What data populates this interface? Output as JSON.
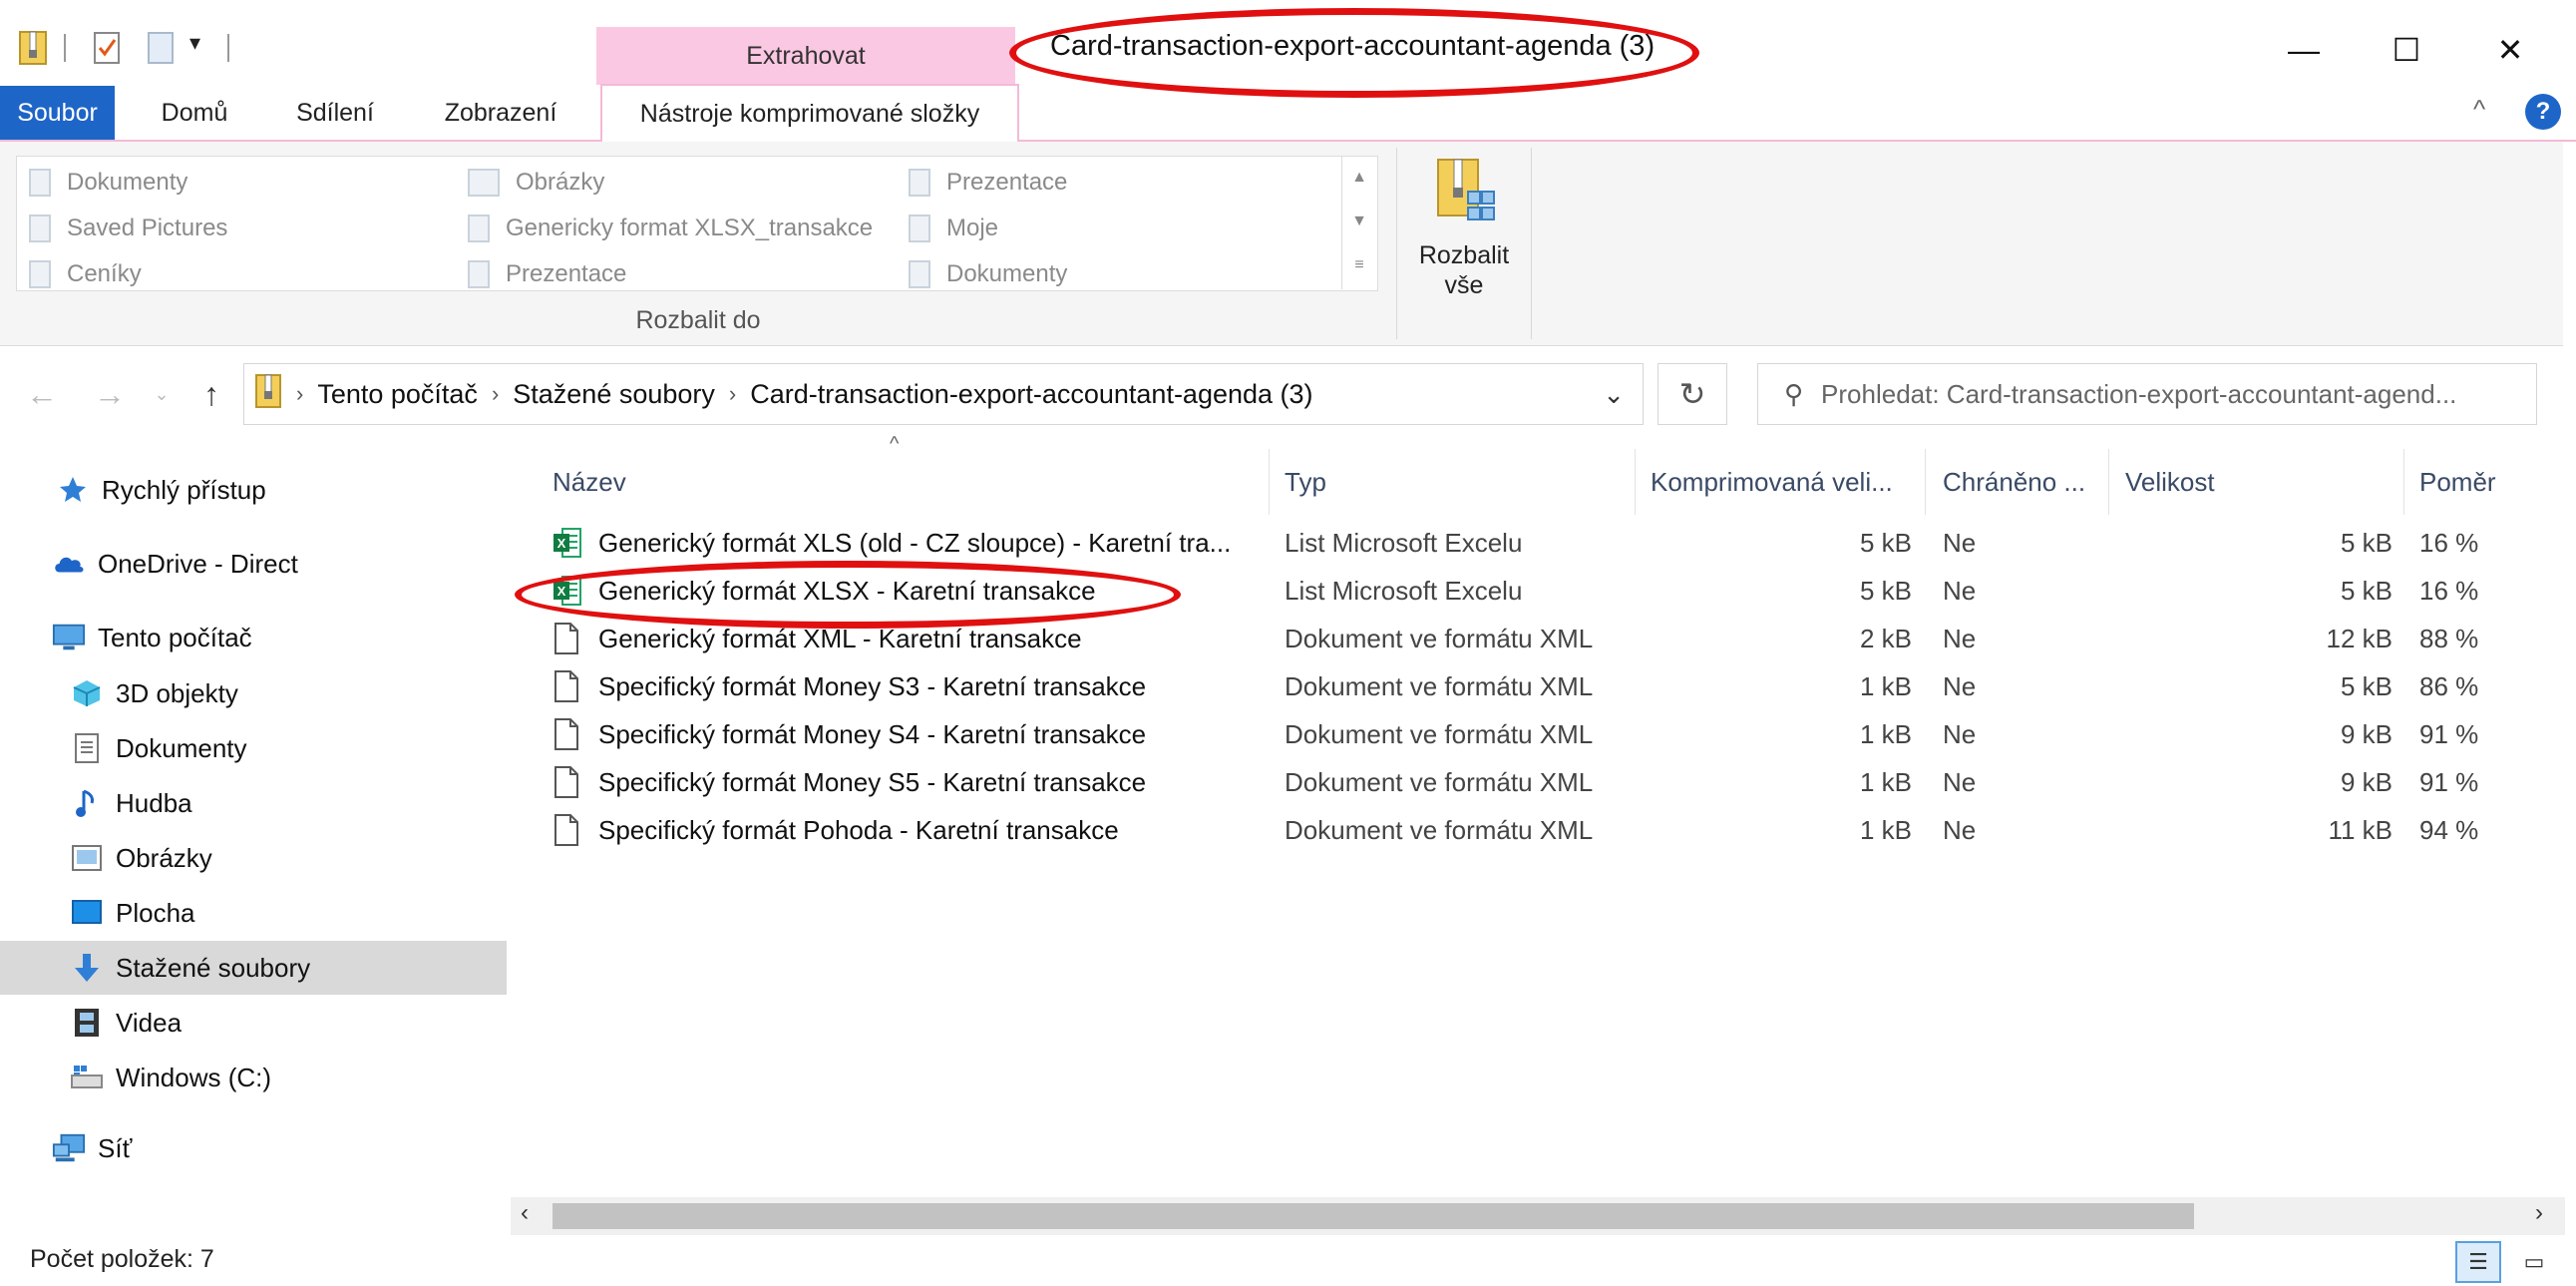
{
  "window": {
    "title": "Card-transaction-export-accountant-agenda (3)",
    "controls": [
      "—",
      "☐",
      "✕"
    ]
  },
  "ribbon": {
    "context_tab_group": "Extrahovat",
    "tabs": [
      "Soubor",
      "Domů",
      "Sdílení",
      "Zobrazení",
      "Nástroje komprimované složky"
    ],
    "gallery": [
      [
        "Dokumenty",
        "Obrázky",
        "Prezentace"
      ],
      [
        "Saved Pictures",
        "Genericky format XLSX_transakce",
        "Moje"
      ],
      [
        "Ceníky",
        "Prezentace",
        "Dokumenty"
      ]
    ],
    "group_label": "Rozbalit do",
    "extract_all_line1": "Rozbalit",
    "extract_all_line2": "vše",
    "help": "?",
    "collapse": "^"
  },
  "address": {
    "crumbs": [
      "Tento počítač",
      "Stažené soubory",
      "Card-transaction-export-accountant-agenda (3)"
    ],
    "search_placeholder": "Prohledat: Card-transaction-export-accountant-agend..."
  },
  "nav_pane": {
    "quick_access": "Rychlý přístup",
    "onedrive": "OneDrive - Direct",
    "this_pc": "Tento počítač",
    "children": [
      "3D objekty",
      "Dokumenty",
      "Hudba",
      "Obrázky",
      "Plocha",
      "Stažené soubory",
      "Videa",
      "Windows (C:)"
    ],
    "network": "Síť"
  },
  "columns": {
    "name": "Název",
    "type": "Typ",
    "compressed": "Komprimovaná veli...",
    "protected": "Chráněno ...",
    "size": "Velikost",
    "ratio": "Poměr"
  },
  "files": [
    {
      "name": "Generický formát XLS (old - CZ sloupce) - Karetní tra...",
      "type": "List Microsoft Excelu",
      "compressed": "5 kB",
      "protected": "Ne",
      "size": "5 kB",
      "ratio": "16 %",
      "icon": "excel-file-icon"
    },
    {
      "name": "Generický formát XLSX - Karetní transakce",
      "type": "List Microsoft Excelu",
      "compressed": "5 kB",
      "protected": "Ne",
      "size": "5 kB",
      "ratio": "16 %",
      "icon": "excel-file-icon"
    },
    {
      "name": "Generický formát XML - Karetní transakce",
      "type": "Dokument ve formátu XML",
      "compressed": "2 kB",
      "protected": "Ne",
      "size": "12 kB",
      "ratio": "88 %",
      "icon": "xml-file-icon"
    },
    {
      "name": "Specifický formát Money S3 - Karetní transakce",
      "type": "Dokument ve formátu XML",
      "compressed": "1 kB",
      "protected": "Ne",
      "size": "5 kB",
      "ratio": "86 %",
      "icon": "xml-file-icon"
    },
    {
      "name": "Specifický formát Money S4 - Karetní transakce",
      "type": "Dokument ve formátu XML",
      "compressed": "1 kB",
      "protected": "Ne",
      "size": "9 kB",
      "ratio": "91 %",
      "icon": "xml-file-icon"
    },
    {
      "name": "Specifický formát Money S5 - Karetní transakce",
      "type": "Dokument ve formátu XML",
      "compressed": "1 kB",
      "protected": "Ne",
      "size": "9 kB",
      "ratio": "91 %",
      "icon": "xml-file-icon"
    },
    {
      "name": "Specifický formát Pohoda - Karetní transakce",
      "type": "Dokument ve formátu XML",
      "compressed": "1 kB",
      "protected": "Ne",
      "size": "11 kB",
      "ratio": "94 %",
      "icon": "xml-file-icon"
    }
  ],
  "status": {
    "item_count": "Počet položek: 7"
  },
  "colors": {
    "accent": "#1e65c8",
    "context_tab": "#fbc8e3",
    "highlight_ellipse": "#e01010"
  }
}
